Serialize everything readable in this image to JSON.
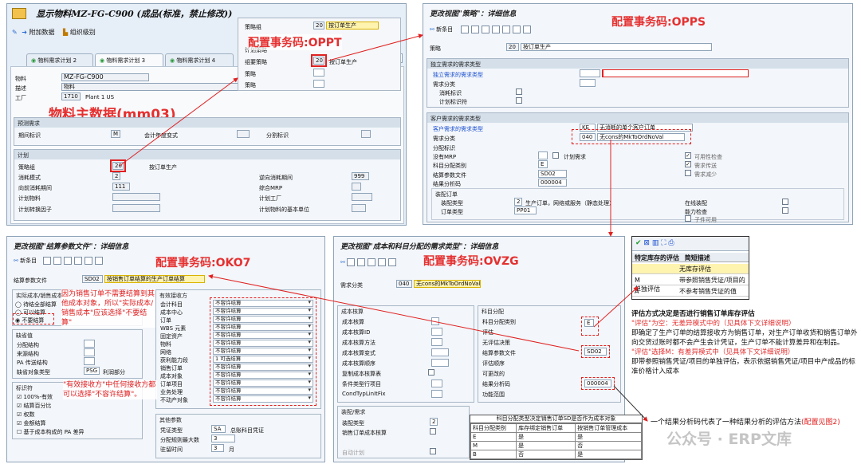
{
  "mm03": {
    "title": "显示物料MZ-FG-C900 (成品(标准，禁止修改))",
    "toolbar_additional": "附加数据",
    "toolbar_orglevels": "组织级别",
    "tabs": [
      "物料需求计划 2",
      "物料需求计划 3",
      "物料需求计划 4"
    ],
    "material_label": "物料",
    "material_value": "MZ-FG-C900",
    "desc_label": "描述",
    "desc_value": "物料",
    "plant_label": "工厂",
    "plant_value": "1710",
    "plant_name": "Plant 1 US",
    "forecast_group": "预测需求",
    "period_label": "期间标识",
    "period_value": "M",
    "fiscal_label": "会计年度变式",
    "split_label": "分割标识",
    "plan_group": "计划",
    "strategy_label": "策略组",
    "strategy_value": "20",
    "strategy_text": "按订单生产",
    "consume_mode_label": "消耗模式",
    "consume_mode_value": "2",
    "backward_label": "逆向消耗期间",
    "backward_value": "999",
    "forward_label": "向前消耗期间",
    "forward_value": "111",
    "mixed_label": "综合MRP",
    "planmat_label": "计划物料",
    "planplant_label": "计划工厂",
    "convfactor_label": "计划转换因子",
    "planunit_label": "计划物料的基本单位",
    "annotation": "物料主数据(mm03)"
  },
  "oppt": {
    "row1_label": "策略组",
    "row1_value": "20",
    "row1_text": "按订单生产",
    "section": "计划策略",
    "row2_label": "组要策略",
    "row2_value": "20",
    "row2_text": "按订单生产",
    "row3_label": "策略",
    "row4_label": "策略",
    "annotation": "配置事务码:OPPT"
  },
  "opps": {
    "title": "更改视图\"策略\"：详细信息",
    "toolbar_new": "新条目",
    "strategy_label": "策略",
    "strategy_value": "20",
    "strategy_text": "按订单生产",
    "indep_group": "独立需求的需求类型",
    "indep_type": "独立需求的需求类型",
    "req_class": "需求分类",
    "consume": "消耗标识",
    "plan_flag": "计划标识符",
    "cust_group": "客户需求的需求类型",
    "cust_type": "客户需求的需求类型",
    "cust_type_value": "KE",
    "cust_type_text": "无消耗的单个客户订单",
    "cust_class": "需求分类",
    "cust_class_value": "040",
    "cust_class_text": "无cons的MkToOrdNoVal",
    "alloc": "分配标识",
    "no_mrp": "没有MRP",
    "plan_req": "计划需求",
    "avail_check": "可用性检查",
    "req_transfer": "需求传送",
    "req_reduce": "需求减少",
    "acct_cat": "科目分配类别",
    "acct_cat_value": "E",
    "settle_profile": "结算参数文件",
    "settle_profile_value": "SD02",
    "result_analysis": "结果分析码",
    "result_analysis_value": "000004",
    "assembly_group": "装配订单",
    "assembly_type": "装配类型",
    "assembly_type_value": "2",
    "assembly_type_text": "生产订单，网络或服务（静态处理）",
    "online_assy": "在线装配",
    "order_type": "订单类型",
    "order_type_value": "PP01",
    "capacity": "能力检查",
    "component": "子件可用",
    "annotation": "配置事务码:OPPS"
  },
  "oko7": {
    "title": "更改视图\"结算参数文件\"：详细信息",
    "toolbar_new": "新条目",
    "profile_label": "结算参数文件",
    "profile_value": "SD02",
    "profile_text": "按销售订单结算的生产订单结算",
    "actual_group": "实际成本/销售成本",
    "opt1": "待结全部结算",
    "opt2": "可以结算",
    "opt3": "不要结算",
    "receiver_group": "有效接收方",
    "receivers": [
      "会计科目",
      "成本中心",
      "订单",
      "WBS 元素",
      "固定资产",
      "物料",
      "网络",
      "获利能力段",
      "销售订单",
      "成本对象",
      "订单项目",
      "业务处理",
      "不动产对象"
    ],
    "receiver_values": [
      "不容许结算",
      "不容许结算",
      "不容许结算",
      "不容许结算",
      "不容许结算",
      "不容许结算",
      "不容许结算",
      "1 可选结算",
      "不容许结算",
      "不容许结算",
      "不容许结算",
      "不容许结算",
      "不容许结算"
    ],
    "default_group": "缺省值",
    "alloc_struct": "分配结构",
    "source_struct": "来源结构",
    "pa_struct": "PA 传送结构",
    "default_obj": "缺省对象类型",
    "default_obj_value": "PSG",
    "default_obj_text": "利润部分",
    "indicators_group": "标识符",
    "ind1": "100%-有效",
    "ind2": "结算百分比",
    "ind3": "权数",
    "ind4": "金额结算",
    "ind5": "基于成本构成的 PA 差异",
    "other_group": "其他参数",
    "doc_type": "凭证类型",
    "doc_type_value": "SA",
    "doc_type_text": "总账科目凭证",
    "max_rules": "分配规则最大数",
    "max_rules_value": "3",
    "residence": "驻留时间",
    "residence_value": "3",
    "residence_unit": "月",
    "annotation": "配置事务码:OKO7",
    "note1": "因为销售订单不需要结算到其他成本对象，所以\"实际成本/销售成本\"应该选择\"不要结算\"",
    "note2": "\"有效接收方\"中任何接收方都可以选择\"不容许结算\"。"
  },
  "ovzg": {
    "title": "更改视图\"成本和科目分配的需求类型\"：详细信息",
    "req_class_label": "需求分类",
    "req_class_value": "040",
    "req_class_text": "无cons的MkToOrdNoVal",
    "costing_group": "成本核算",
    "costing_items": [
      "成本核算",
      "成本核算ID",
      "成本核算方法",
      "成本核算变式",
      "成本核算顺序",
      "复制成本核算表",
      "条件类型行项目",
      "CondTypLinItFix"
    ],
    "acct_group": "科目分配",
    "acct_items": [
      "科目分配类别",
      "评估",
      "无评估决策",
      "结算参数文件",
      "评估顺序",
      "可更改的",
      "结果分析码",
      "功能范围"
    ],
    "acct_cat_value": "E",
    "settle_value": "SD02",
    "ra_value": "000004",
    "assembly_group": "装配/需求",
    "assembly_type": "装配类型",
    "assembly_value": "2",
    "so_cost": "销售订单成本核算",
    "auto_plan": "自动计划",
    "annotation": "配置事务码:OVZG"
  },
  "popup": {
    "title": "特定库存的评估",
    "col_desc": "简短描述",
    "rows": [
      {
        "code": "",
        "desc": "无库存评估"
      },
      {
        "code": "M",
        "desc": "带参照销售凭证/项目的单独评估"
      },
      {
        "code": "A",
        "desc": "不参考销售凭证的值"
      }
    ]
  },
  "explain": {
    "heading": "评估方式决定是否进行销售订单库存评估",
    "red1": "\"评估\"为空：无差异模式中的（见具体下文详细说明）",
    "black1": "即确定了生产订单的结算接收方为销售订单，对生产订单收货和销售订单外向交货过账时都不会产生会计凭证，生产订单不能计算差异和在制品。",
    "red2": "\"评估\"选择M：有差异模式中（见具体下文详细说明）",
    "black2": "即带参照销售凭证/项目的单独评估，表示依据销售凭证/项目中产成品的标准价格计入成本"
  },
  "ra_table": {
    "title": "科目分配类型决定销售订单SD是否作为成本对象",
    "headers": [
      "科目分配类别",
      "库存绑定销售订单",
      "按销售订单管理成本"
    ],
    "rows": [
      [
        "E",
        "是",
        "是"
      ],
      [
        "M",
        "是",
        "否"
      ],
      [
        "B",
        "否",
        "是"
      ]
    ]
  },
  "bottom_note": {
    "text": "一个结果分析码代表了一种结果分析的评估方法",
    "link": "(配置见图2)"
  },
  "watermark": "公众号 · ERP文库"
}
